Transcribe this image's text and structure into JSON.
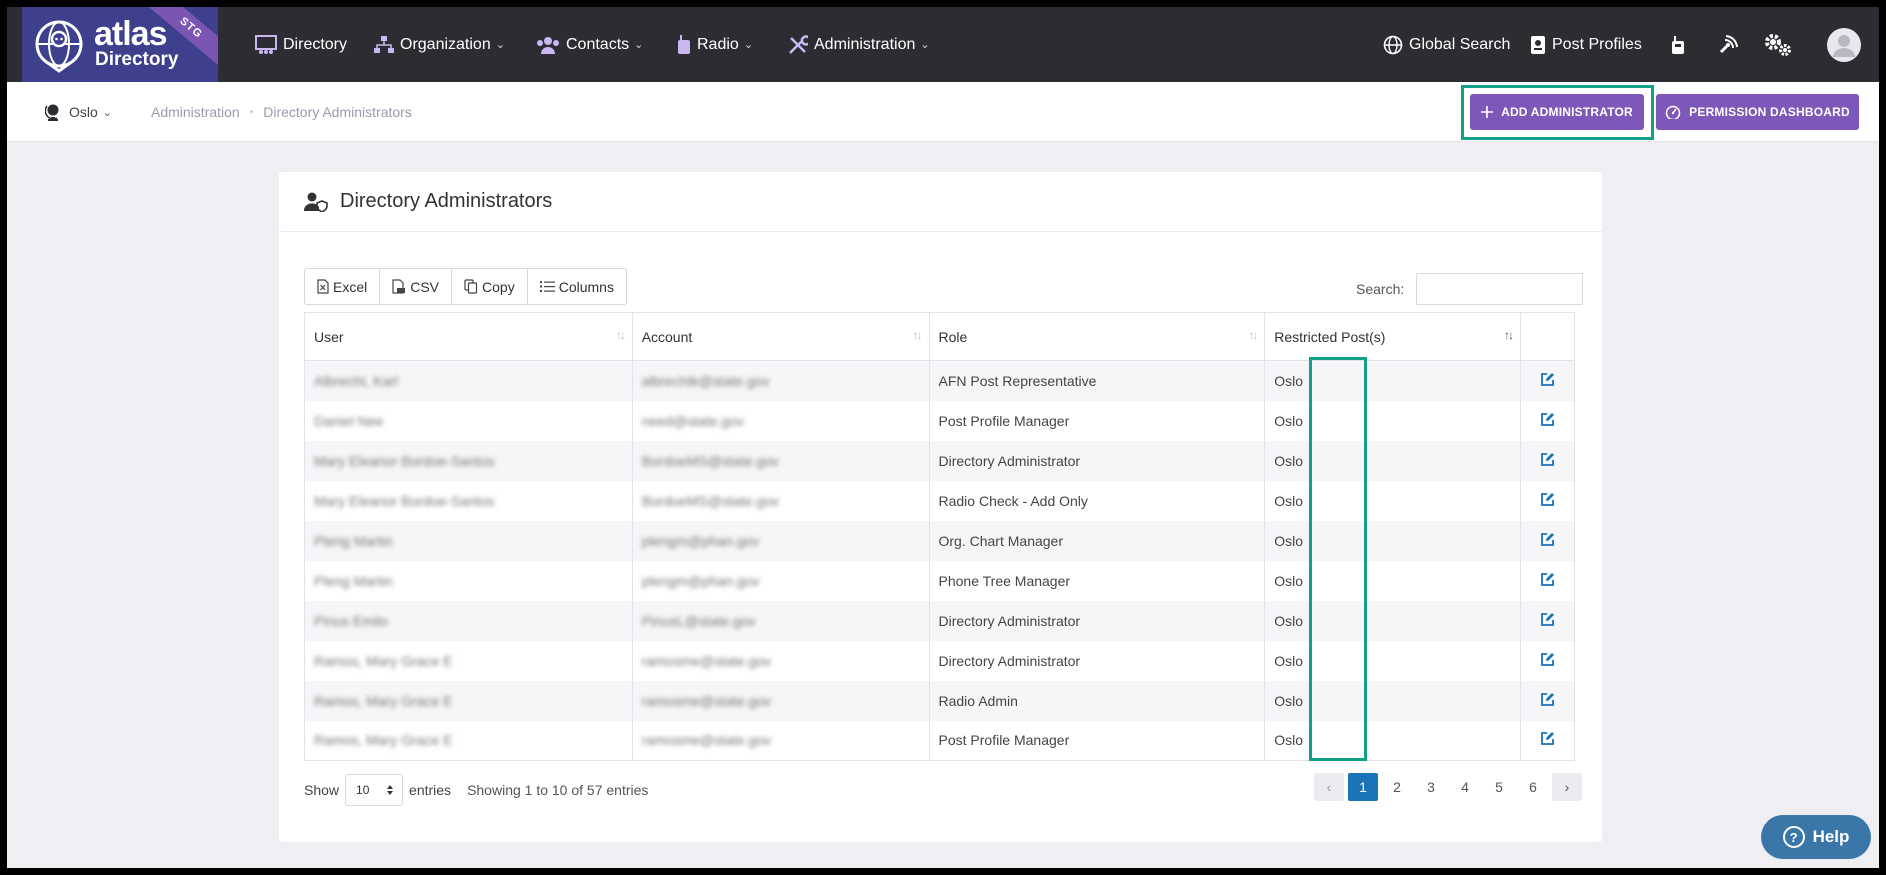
{
  "brand": {
    "name": "atlas",
    "sub": "Directory",
    "env": "STG"
  },
  "nav": {
    "items": [
      {
        "label": "Directory",
        "has_menu": false
      },
      {
        "label": "Organization",
        "has_menu": true
      },
      {
        "label": "Contacts",
        "has_menu": true
      },
      {
        "label": "Radio",
        "has_menu": true
      },
      {
        "label": "Administration",
        "has_menu": true
      }
    ],
    "global_search": "Global Search",
    "post_profiles": "Post Profiles"
  },
  "post": {
    "label": "Oslo"
  },
  "breadcrumb": [
    "Administration",
    "Directory Administrators"
  ],
  "actions": {
    "add_admin": "ADD ADMINISTRATOR",
    "permission_dashboard": "PERMISSION DASHBOARD"
  },
  "card": {
    "title": "Directory Administrators"
  },
  "export_buttons": [
    "Excel",
    "CSV",
    "Copy",
    "Columns"
  ],
  "search": {
    "label": "Search:",
    "value": ""
  },
  "table": {
    "columns": [
      "User",
      "Account",
      "Role",
      "Restricted Post(s)"
    ],
    "rows": [
      {
        "user": "Albrecht, Karl",
        "account": "albrechtk@state.gov",
        "role": "AFN Post Representative",
        "post": "Oslo"
      },
      {
        "user": "Daniel Nee",
        "account": "need@state.gov",
        "role": "Post Profile Manager",
        "post": "Oslo"
      },
      {
        "user": "Mary Eleanor Bordoe-Santos",
        "account": "BordoeMS@state.gov",
        "role": "Directory Administrator",
        "post": "Oslo"
      },
      {
        "user": "Mary Eleanor Bordoe-Santos",
        "account": "BordoeMS@state.gov",
        "role": "Radio Check - Add Only",
        "post": "Oslo"
      },
      {
        "user": "Pleng Martin",
        "account": "plengm@phan.gov",
        "role": "Org. Chart Manager",
        "post": "Oslo"
      },
      {
        "user": "Pleng Martin",
        "account": "plengm@phan.gov",
        "role": "Phone Tree Manager",
        "post": "Oslo"
      },
      {
        "user": "Pinus Emilo",
        "account": "PinusL@state.gov",
        "role": "Directory Administrator",
        "post": "Oslo"
      },
      {
        "user": "Ramos, Mary Grace E",
        "account": "ramosme@state.gov",
        "role": "Directory Administrator",
        "post": "Oslo"
      },
      {
        "user": "Ramos, Mary Grace E",
        "account": "ramosme@state.gov",
        "role": "Radio Admin",
        "post": "Oslo"
      },
      {
        "user": "Ramos, Mary Grace E",
        "account": "ramosme@state.gov",
        "role": "Post Profile Manager",
        "post": "Oslo"
      }
    ]
  },
  "footer": {
    "show": "Show",
    "page_size": "10",
    "entries": "entries",
    "info": "Showing 1 to 10 of 57 entries"
  },
  "pagination": {
    "pages": [
      "1",
      "2",
      "3",
      "4",
      "5",
      "6"
    ],
    "current": "1"
  },
  "help": {
    "label": "Help"
  },
  "colors": {
    "nav_bg": "#2c2c32",
    "accent": "#7e58b8",
    "highlight": "#12a087",
    "link": "#1a73b6"
  }
}
